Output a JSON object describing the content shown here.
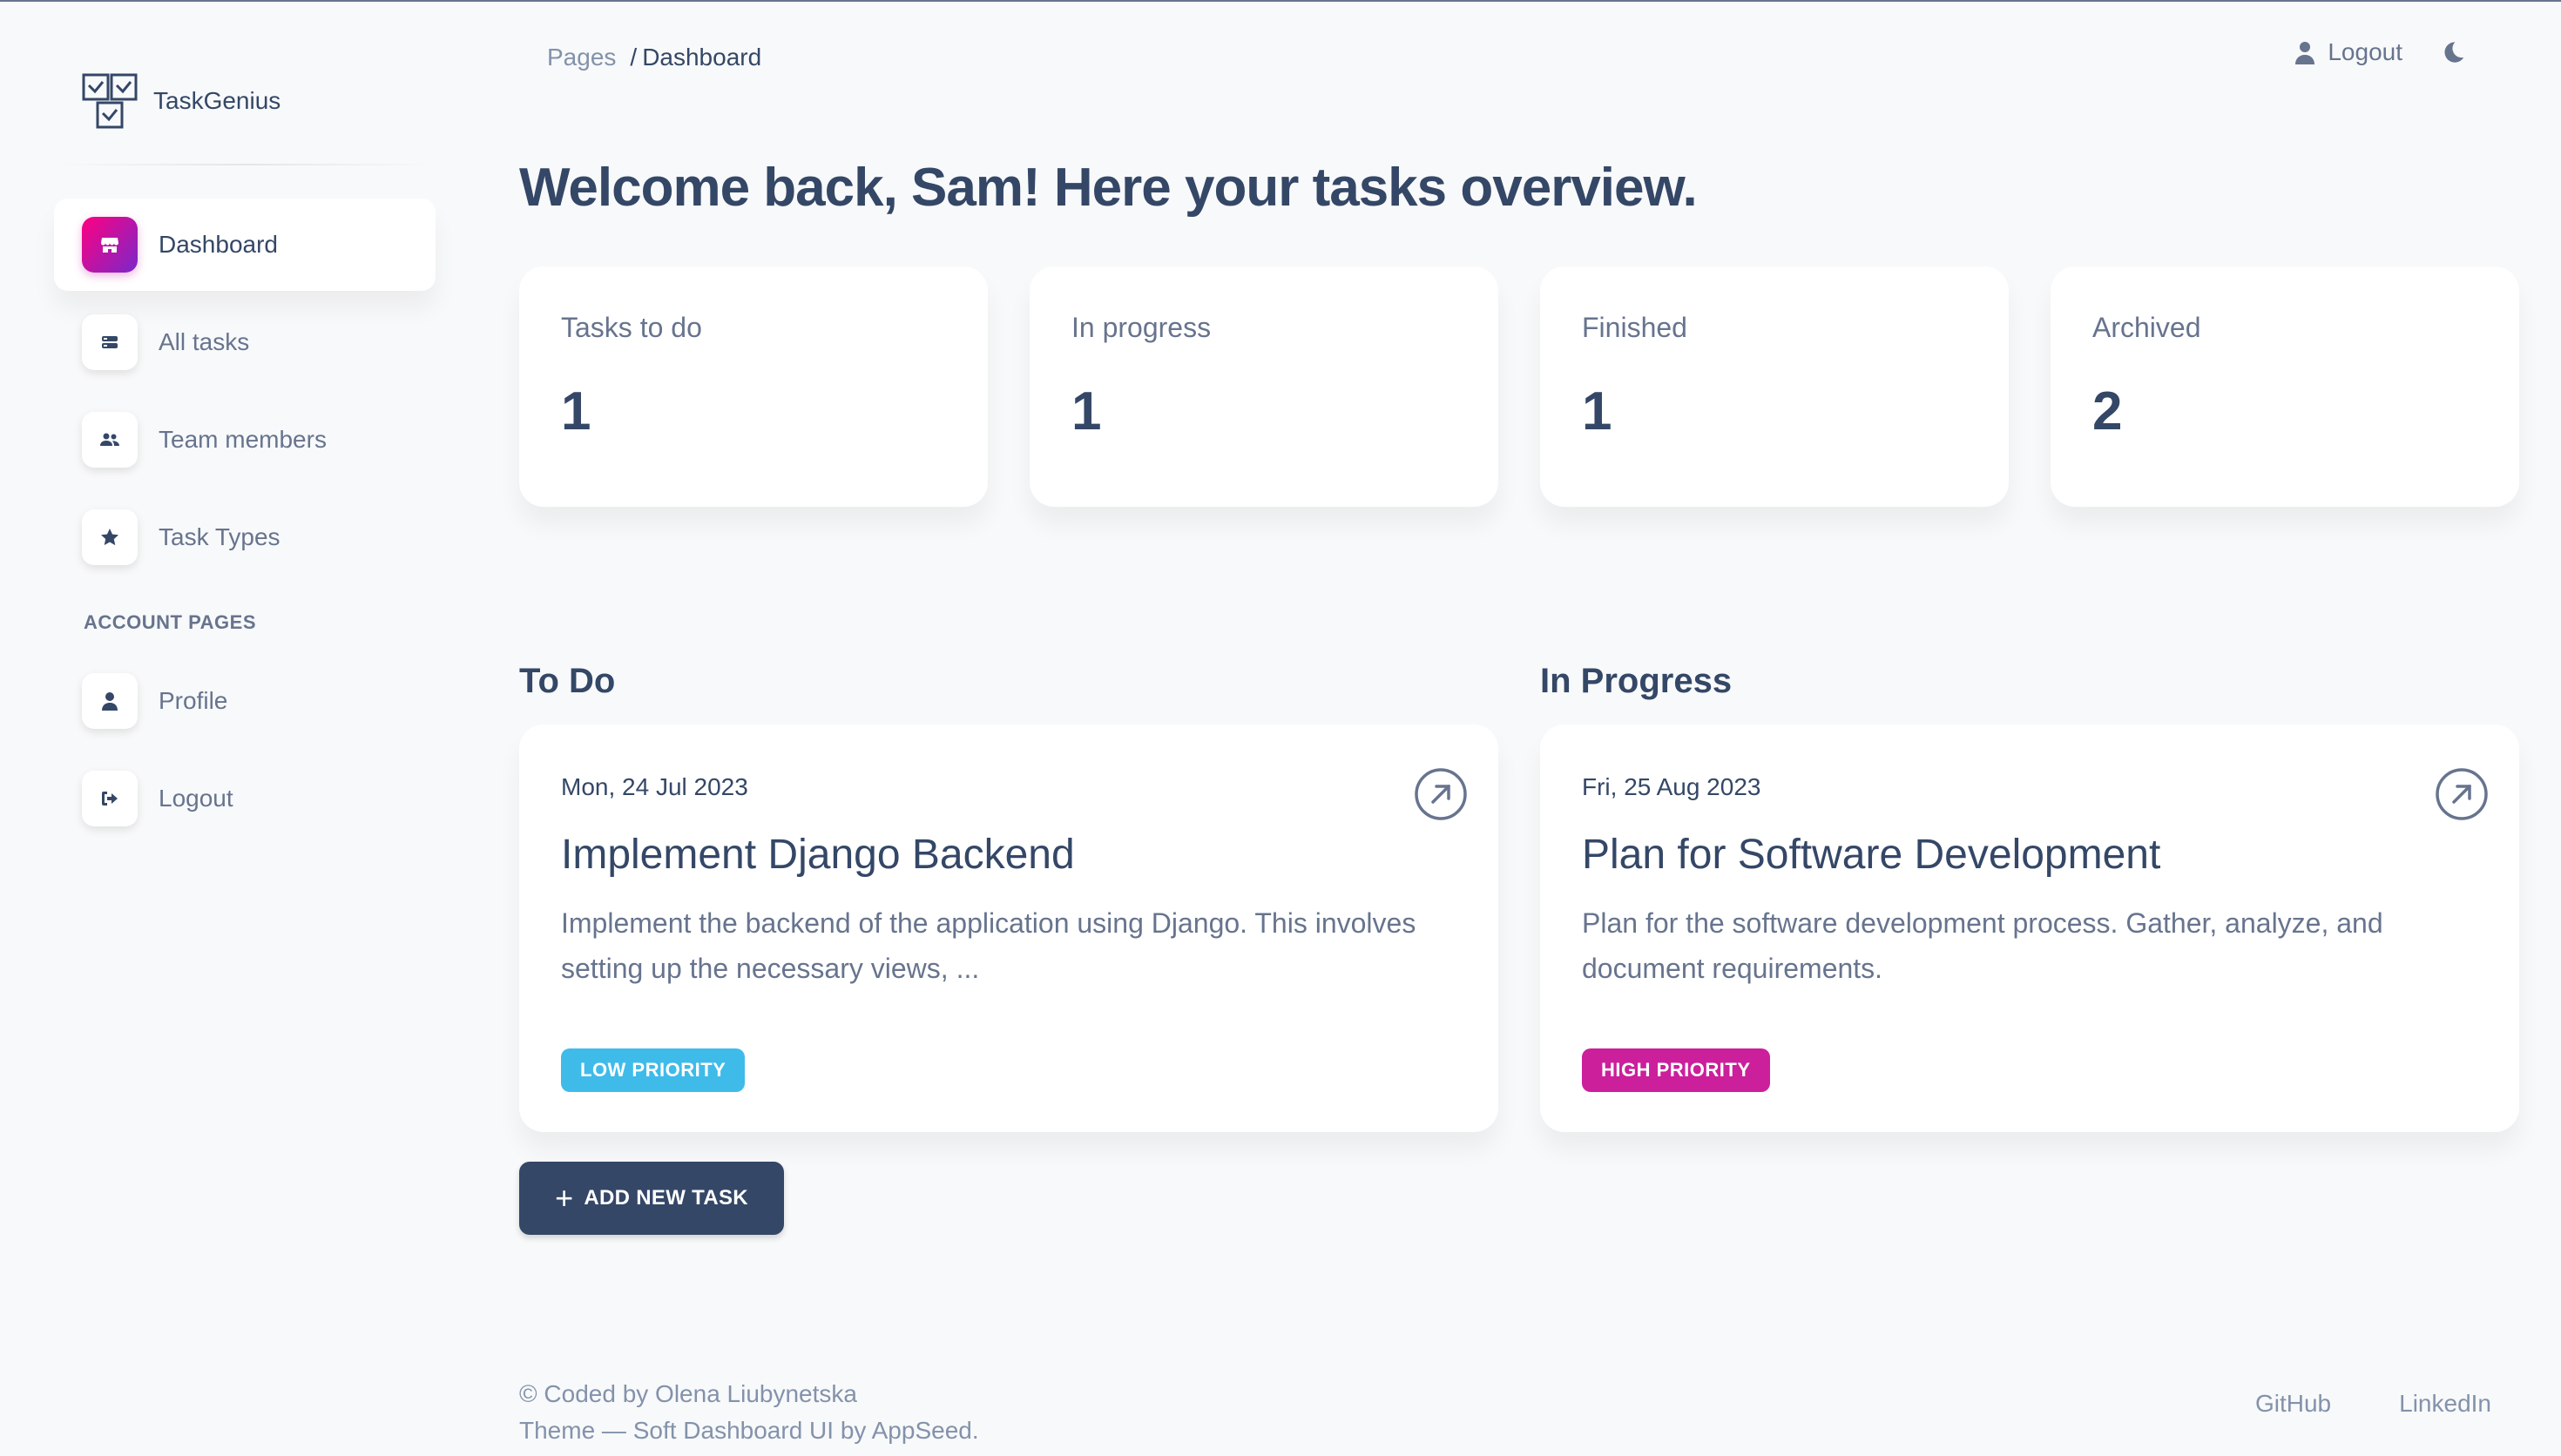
{
  "app": {
    "name": "TaskGenius"
  },
  "sidebar": {
    "items": [
      {
        "label": "Dashboard",
        "icon": "shop-icon"
      },
      {
        "label": "All tasks",
        "icon": "list-icon"
      },
      {
        "label": "Team members",
        "icon": "users-icon"
      },
      {
        "label": "Task Types",
        "icon": "star-icon"
      }
    ],
    "section_heading": "ACCOUNT PAGES",
    "account_items": [
      {
        "label": "Profile",
        "icon": "user-icon"
      },
      {
        "label": "Logout",
        "icon": "sign-out-icon"
      }
    ]
  },
  "header": {
    "breadcrumb_pages": "Pages",
    "breadcrumb_sep": "/",
    "breadcrumb_current": "Dashboard",
    "logout_label": "Logout"
  },
  "welcome": "Welcome back, Sam! Here your tasks overview.",
  "stats": [
    {
      "label": "Tasks to do",
      "value": "1"
    },
    {
      "label": "In progress",
      "value": "1"
    },
    {
      "label": "Finished",
      "value": "1"
    },
    {
      "label": "Archived",
      "value": "2"
    }
  ],
  "sections": {
    "todo_title": "To Do",
    "inprogress_title": "In Progress"
  },
  "tasks": [
    {
      "date": "Mon, 24 Jul 2023",
      "title": "Implement Django Backend",
      "description": "Implement the backend of the application using Django. This involves setting up the necessary views, ...",
      "priority": "LOW PRIORITY",
      "priority_color": "#3fbbea"
    },
    {
      "date": "Fri, 25 Aug 2023",
      "title": "Plan for Software Development",
      "description": "Plan for the software development process. Gather, analyze, and document requirements.",
      "priority": "HIGH PRIORITY",
      "priority_color": "#cb1f9b"
    }
  ],
  "add_task_label": "ADD NEW TASK",
  "footer": {
    "credit": "© Coded by Olena Liubynetska",
    "theme": "Theme — Soft Dashboard UI by AppSeed.",
    "links": [
      "GitHub",
      "LinkedIn"
    ]
  },
  "colors": {
    "primary": "#344767",
    "secondary": "#67748e",
    "accent": "#cb0c9f"
  }
}
